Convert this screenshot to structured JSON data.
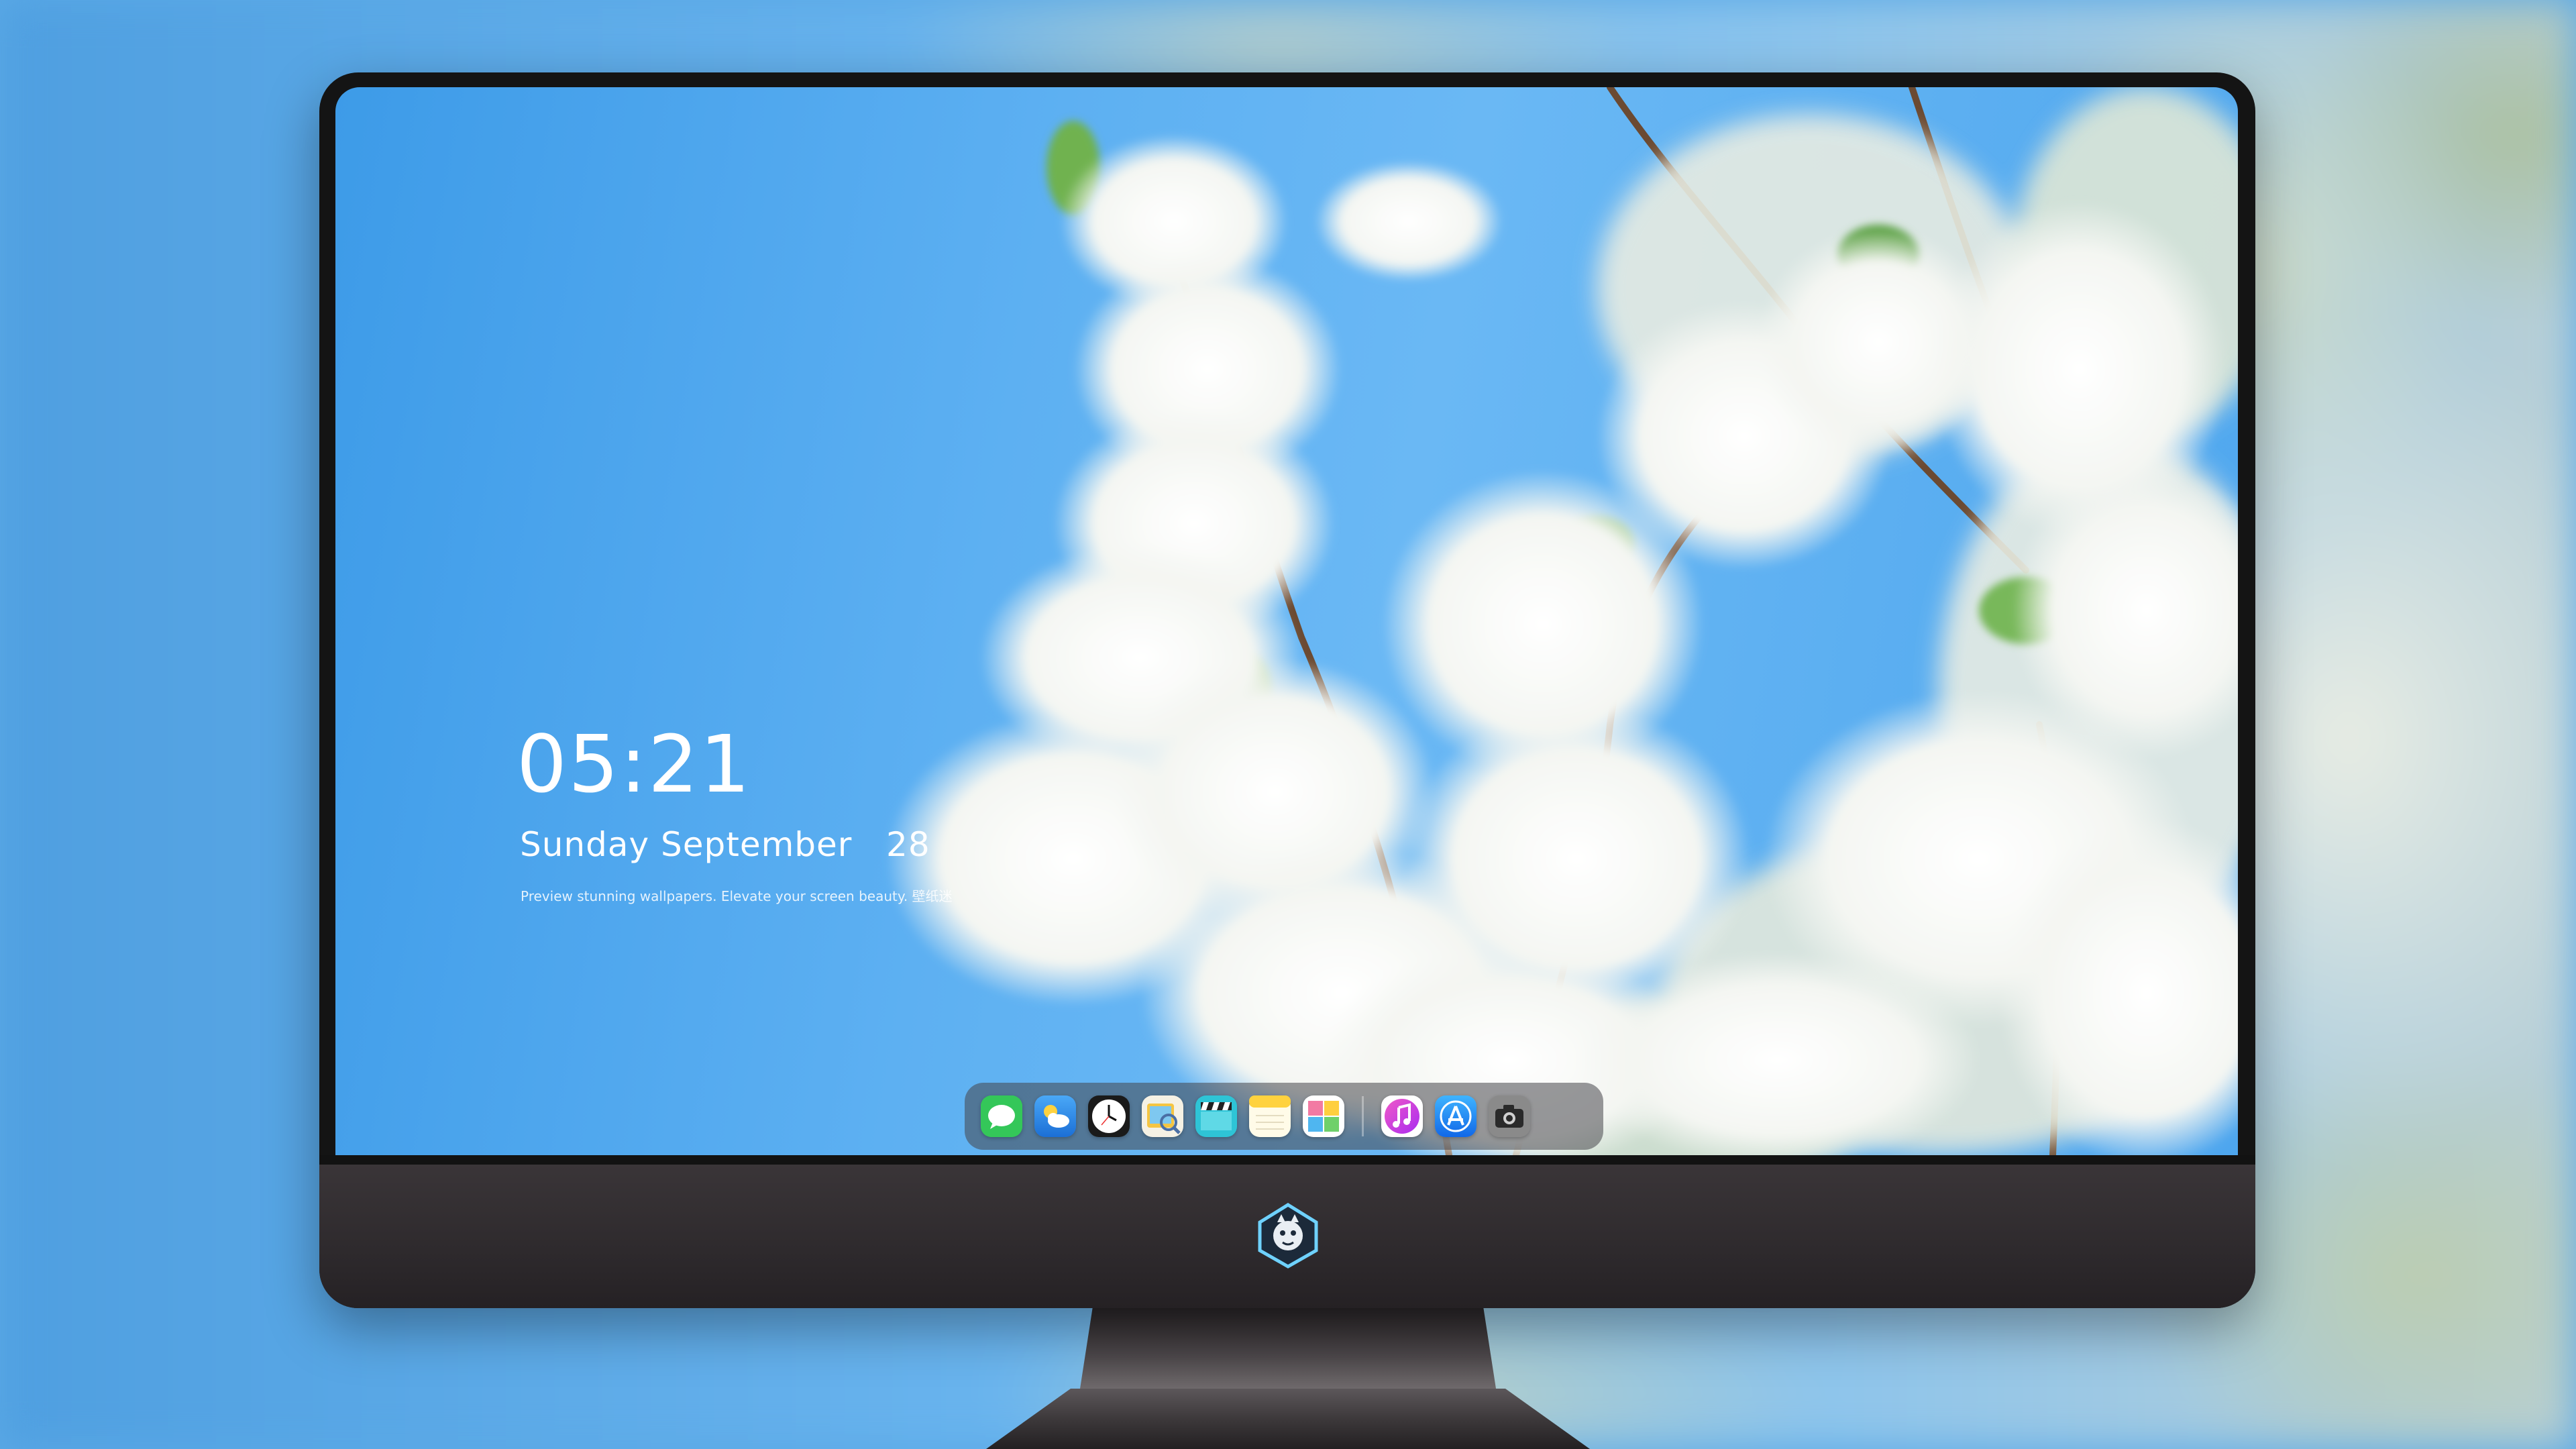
{
  "lockscreen": {
    "time": "05:21",
    "date": "Sunday September   28",
    "tagline": "Preview stunning wallpapers. Elevate your screen beauty. 壁纸迷"
  },
  "dock": {
    "items": [
      {
        "id": "messages",
        "icon": "messages-icon",
        "color": "#34c759"
      },
      {
        "id": "weather",
        "icon": "weather-icon",
        "color": "#2f8ff0"
      },
      {
        "id": "clock",
        "icon": "clock-icon",
        "color": "#ffffff"
      },
      {
        "id": "preview",
        "icon": "preview-icon",
        "color": "#f5c542"
      },
      {
        "id": "video",
        "icon": "clapperboard-icon",
        "color": "#2ec4d6"
      },
      {
        "id": "notes",
        "icon": "notes-icon",
        "color": "#ffd23f"
      },
      {
        "id": "photos",
        "icon": "photos-icon",
        "color": "#f3a3c0"
      },
      {
        "id": "music",
        "icon": "music-icon",
        "color": "#d63cf0"
      },
      {
        "id": "app-store",
        "icon": "app-store-icon",
        "color": "#1e8ef5"
      },
      {
        "id": "camera",
        "icon": "camera-icon",
        "color": "#6b6b6b"
      }
    ]
  },
  "colors": {
    "sky": "#5db0f2",
    "monitor_frame": "#141414",
    "chin": "#2e2a2d"
  }
}
